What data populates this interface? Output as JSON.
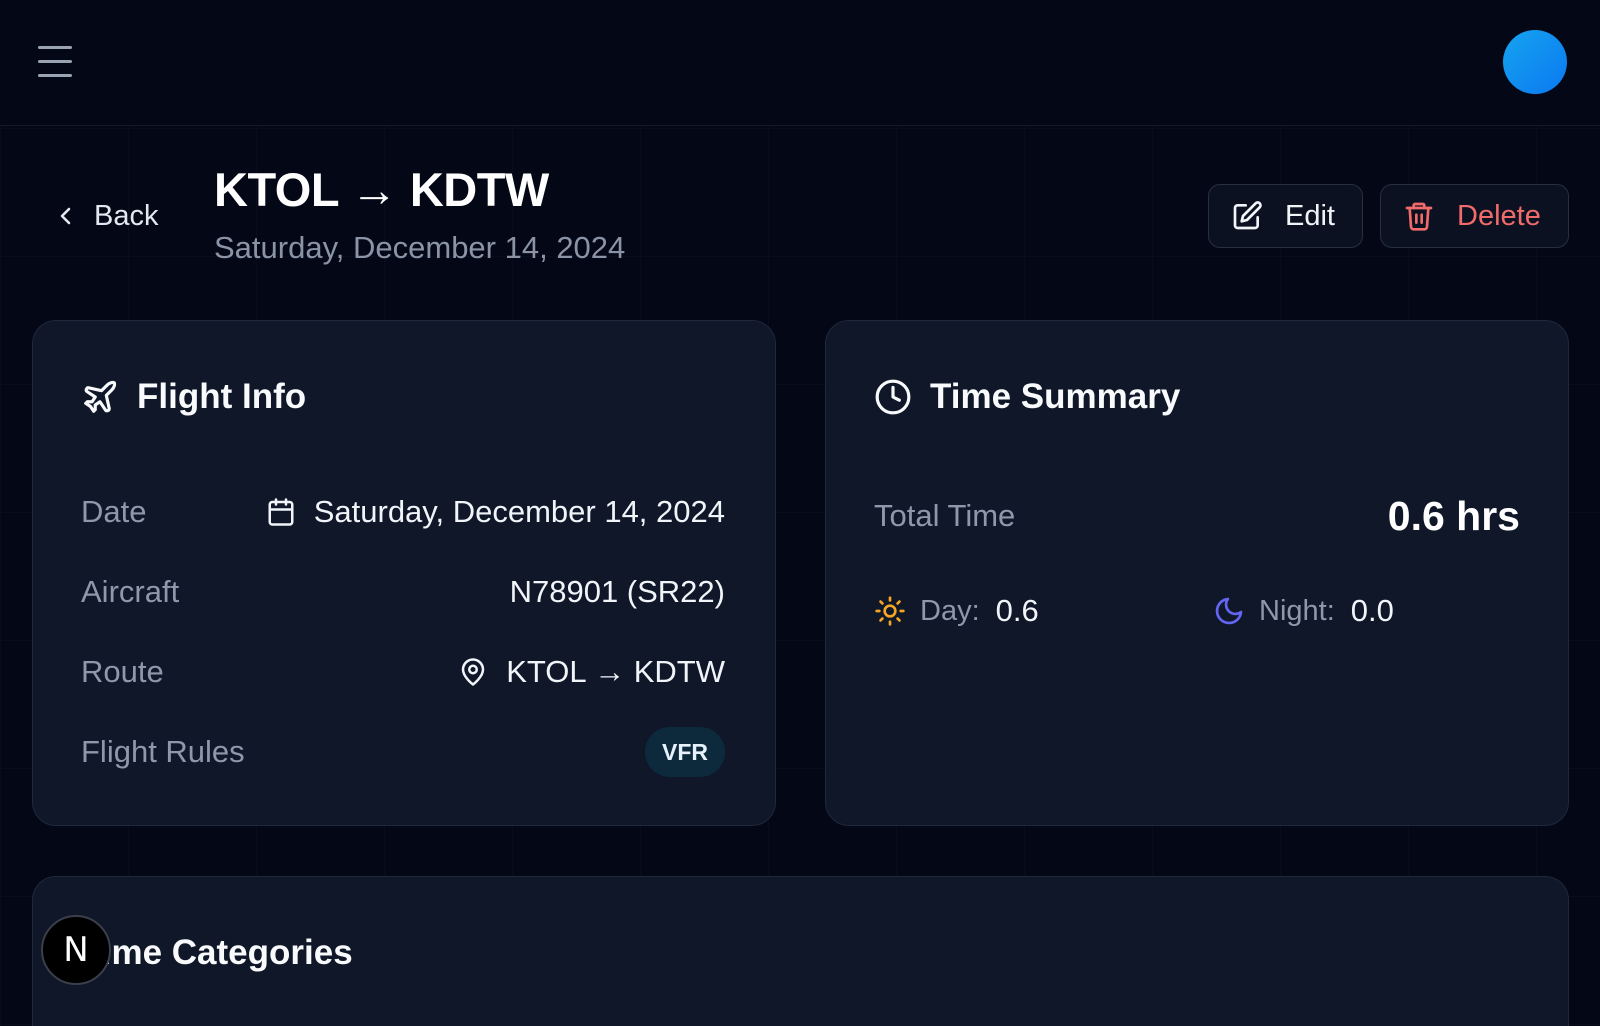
{
  "header": {
    "menu_icon": "hamburger-icon",
    "avatar_color": "#0a8ff0"
  },
  "page": {
    "back_label": "Back",
    "title": "KTOL → KDTW",
    "subtitle": "Saturday, December 14, 2024",
    "edit_label": "Edit",
    "delete_label": "Delete",
    "delete_color": "#f26b6b"
  },
  "flight_info": {
    "title": "Flight Info",
    "rows": [
      {
        "label": "Date",
        "value": "Saturday, December 14, 2024",
        "icon": "calendar-icon"
      },
      {
        "label": "Aircraft",
        "value": "N78901 (SR22)"
      },
      {
        "label": "Route",
        "value": "KTOL → KDTW",
        "icon": "map-pin-icon"
      },
      {
        "label": "Flight Rules",
        "value": "VFR"
      }
    ]
  },
  "time_summary": {
    "title": "Time Summary",
    "total_label": "Total Time",
    "total_value": "0.6 hrs",
    "day_label": "Day:",
    "day_value": "0.6",
    "night_label": "Night:",
    "night_value": "0.0"
  },
  "time_categories": {
    "title": "Time Categories"
  },
  "dev_badge": {
    "label": "N"
  }
}
